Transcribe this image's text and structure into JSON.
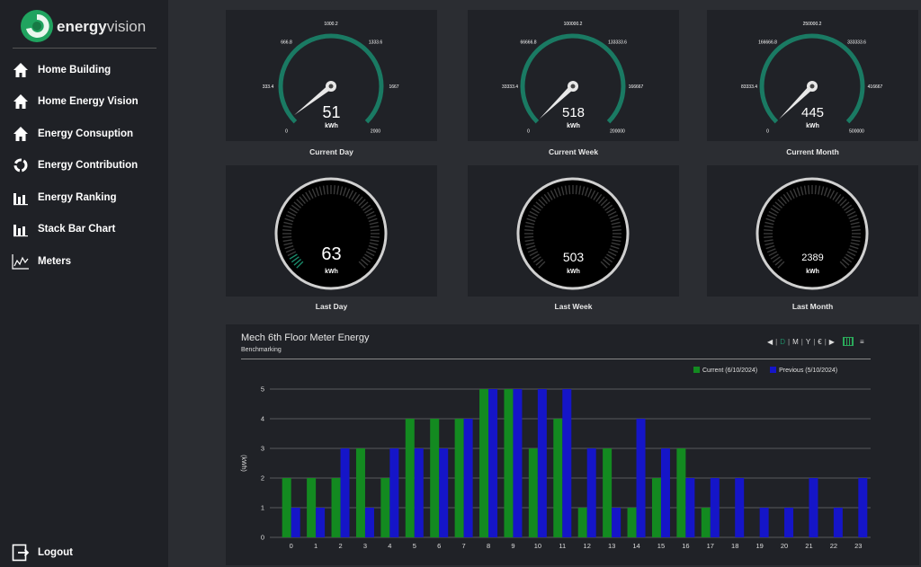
{
  "brand": {
    "name_bold": "energy",
    "name_light": "vision"
  },
  "colors": {
    "accent": "#1e8a64",
    "current": "#138a20",
    "previous": "#1515c8",
    "gauge_arc": "#1a7a63"
  },
  "sidebar": {
    "items": [
      {
        "label": "Home Building",
        "icon": "home-icon"
      },
      {
        "label": "Home Energy Vision",
        "icon": "home-icon"
      },
      {
        "label": "Energy Consuption",
        "icon": "home-icon"
      },
      {
        "label": "Energy Contribution",
        "icon": "recycle-icon"
      },
      {
        "label": "Energy Ranking",
        "icon": "bar-chart-icon"
      },
      {
        "label": "Stack Bar Chart",
        "icon": "bar-chart-icon"
      },
      {
        "label": "Meters",
        "icon": "line-chart-icon"
      }
    ],
    "logout_label": "Logout"
  },
  "gauges": [
    {
      "label": "Current Day",
      "value": "51",
      "unit": "kWh",
      "ticks": [
        "0",
        "333.4",
        "666.8",
        "1000.2",
        "1333.6",
        "1667",
        "2000"
      ],
      "min": 0,
      "max": 2000,
      "num": 51
    },
    {
      "label": "Current Week",
      "value": "518",
      "unit": "kWh",
      "ticks": [
        "0",
        "33333.4",
        "66666.8",
        "100000.2",
        "133333.6",
        "166667",
        "200000"
      ],
      "min": 0,
      "max": 200000,
      "num": 518
    },
    {
      "label": "Current Month",
      "value": "445",
      "unit": "kWh",
      "ticks": [
        "0",
        "83333.4",
        "166666.8",
        "250000.2",
        "333333.6",
        "416667",
        "500000"
      ],
      "min": 0,
      "max": 500000,
      "num": 445
    }
  ],
  "dials": [
    {
      "label": "Last Day",
      "value": "63",
      "unit": "kWh"
    },
    {
      "label": "Last Week",
      "value": "503",
      "unit": "kWh"
    },
    {
      "label": "Last Month",
      "value": "2389",
      "unit": "kWh"
    }
  ],
  "chart_panel": {
    "title": "Mech 6th Floor Meter Energy",
    "subtitle": "Benchmarking",
    "controls": [
      "◀",
      "|",
      "D",
      "|",
      "M",
      "|",
      "Y",
      "|",
      "€",
      "|",
      "▶"
    ]
  },
  "chart_data": {
    "type": "bar",
    "categories": [
      "0",
      "1",
      "2",
      "3",
      "4",
      "5",
      "6",
      "7",
      "8",
      "9",
      "10",
      "11",
      "12",
      "13",
      "14",
      "15",
      "16",
      "17",
      "18",
      "19",
      "20",
      "21",
      "22",
      "23"
    ],
    "series": [
      {
        "name": "Current (6/10/2024)",
        "values": [
          2,
          2,
          2,
          3,
          2,
          4,
          4,
          4,
          5,
          5,
          3,
          4,
          1,
          3,
          1,
          2,
          3,
          1,
          0,
          0,
          0,
          0,
          0,
          0
        ]
      },
      {
        "name": "Previous (5/10/2024)",
        "values": [
          1,
          1,
          3,
          1,
          3,
          3,
          3,
          4,
          5,
          5,
          5,
          5,
          3,
          1,
          4,
          3,
          2,
          2,
          2,
          1,
          1,
          2,
          1,
          2
        ]
      }
    ],
    "ylabel": "(kWh)",
    "ylim": [
      0,
      5
    ],
    "yticks": [
      "0",
      "1",
      "2",
      "3",
      "4",
      "5"
    ],
    "grid": true,
    "legend_position": "top-right"
  }
}
